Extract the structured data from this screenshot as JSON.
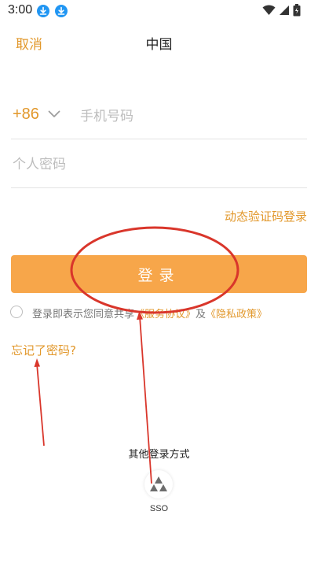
{
  "status_bar": {
    "time": "3:00",
    "icons": [
      "download-icon",
      "download-icon",
      "wifi-icon",
      "signal-icon",
      "battery-icon"
    ]
  },
  "header": {
    "cancel_label": "取消",
    "region_label": "中国"
  },
  "login_form": {
    "country_code": "+86",
    "phone_placeholder": "手机号码",
    "password_placeholder": "个人密码",
    "otp_login_label": "动态验证码登录",
    "login_button_label": "登录",
    "agreement_prefix": "登录即表示您同意共享",
    "terms_link": "《服务协议》",
    "agreement_and": "及",
    "privacy_link": "《隐私政策》",
    "forgot_password_label": "忘记了密码?"
  },
  "other_login": {
    "title": "其他登录方式",
    "sso_label": "SSO"
  },
  "colors": {
    "accent": "#e2982c",
    "button": "#f7a64a",
    "annotation": "#d9362b"
  }
}
